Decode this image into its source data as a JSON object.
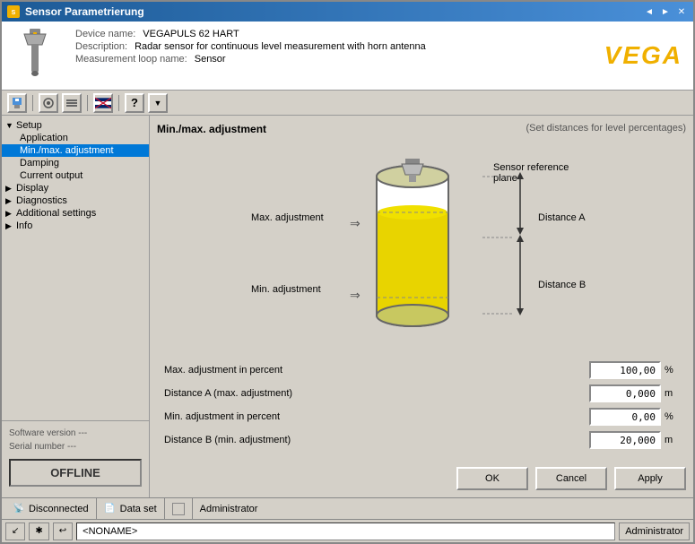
{
  "window": {
    "title": "Sensor Parametrierung",
    "controls": [
      "◄",
      "►",
      "✕"
    ]
  },
  "header": {
    "device_name_label": "Device name:",
    "device_name_value": "VEGAPULS 62 HART",
    "description_label": "Description:",
    "description_value": "Radar sensor for continuous level measurement with horn antenna",
    "loop_name_label": "Measurement loop name:",
    "loop_name_value": "Sensor",
    "logo": "VEGA"
  },
  "toolbar": {
    "buttons": [
      "💾",
      "🔧",
      "🌐",
      "?"
    ]
  },
  "sidebar": {
    "items": [
      {
        "label": "Setup",
        "level": 0,
        "expand": true,
        "selected": false
      },
      {
        "label": "Application",
        "level": 1,
        "expand": false,
        "selected": false
      },
      {
        "label": "Min./max. adjustment",
        "level": 1,
        "expand": false,
        "selected": true
      },
      {
        "label": "Damping",
        "level": 1,
        "expand": false,
        "selected": false
      },
      {
        "label": "Current output",
        "level": 1,
        "expand": false,
        "selected": false
      },
      {
        "label": "Display",
        "level": 0,
        "expand": false,
        "selected": false
      },
      {
        "label": "Diagnostics",
        "level": 0,
        "expand": false,
        "selected": false
      },
      {
        "label": "Additional settings",
        "level": 0,
        "expand": false,
        "selected": false
      },
      {
        "label": "Info",
        "level": 0,
        "expand": false,
        "selected": false
      }
    ],
    "software_version_label": "Software version",
    "software_version_value": "---",
    "serial_number_label": "Serial number",
    "serial_number_value": "---",
    "offline_label": "OFFLINE"
  },
  "panel": {
    "title": "Min./max. adjustment",
    "subtitle": "(Set distances for level percentages)",
    "diagram": {
      "sensor_reference": "Sensor reference plane",
      "max_adjustment": "Max. adjustment",
      "min_adjustment": "Min. adjustment",
      "distance_a": "Distance A",
      "distance_b": "Distance B"
    },
    "fields": [
      {
        "label": "Max. adjustment in percent",
        "value": "100,00",
        "unit": "%"
      },
      {
        "label": "Distance A (max. adjustment)",
        "value": "0,000",
        "unit": "m"
      },
      {
        "label": "Min. adjustment in percent",
        "value": "0,00",
        "unit": "%"
      },
      {
        "label": "Distance B (min. adjustment)",
        "value": "20,000",
        "unit": "m"
      }
    ],
    "buttons": {
      "ok": "OK",
      "cancel": "Cancel",
      "apply": "Apply"
    }
  },
  "status_bar": {
    "segments": [
      {
        "icon": "📡",
        "text": "Disconnected"
      },
      {
        "icon": "📄",
        "text": "Data set"
      },
      {
        "icon": "⬜",
        "text": ""
      },
      {
        "icon": "",
        "text": "Administrator"
      }
    ]
  },
  "taskbar": {
    "btn1": "↙",
    "btn2": "✱",
    "btn3": "↩",
    "name": "<NONAME>",
    "admin": "Administrator"
  }
}
